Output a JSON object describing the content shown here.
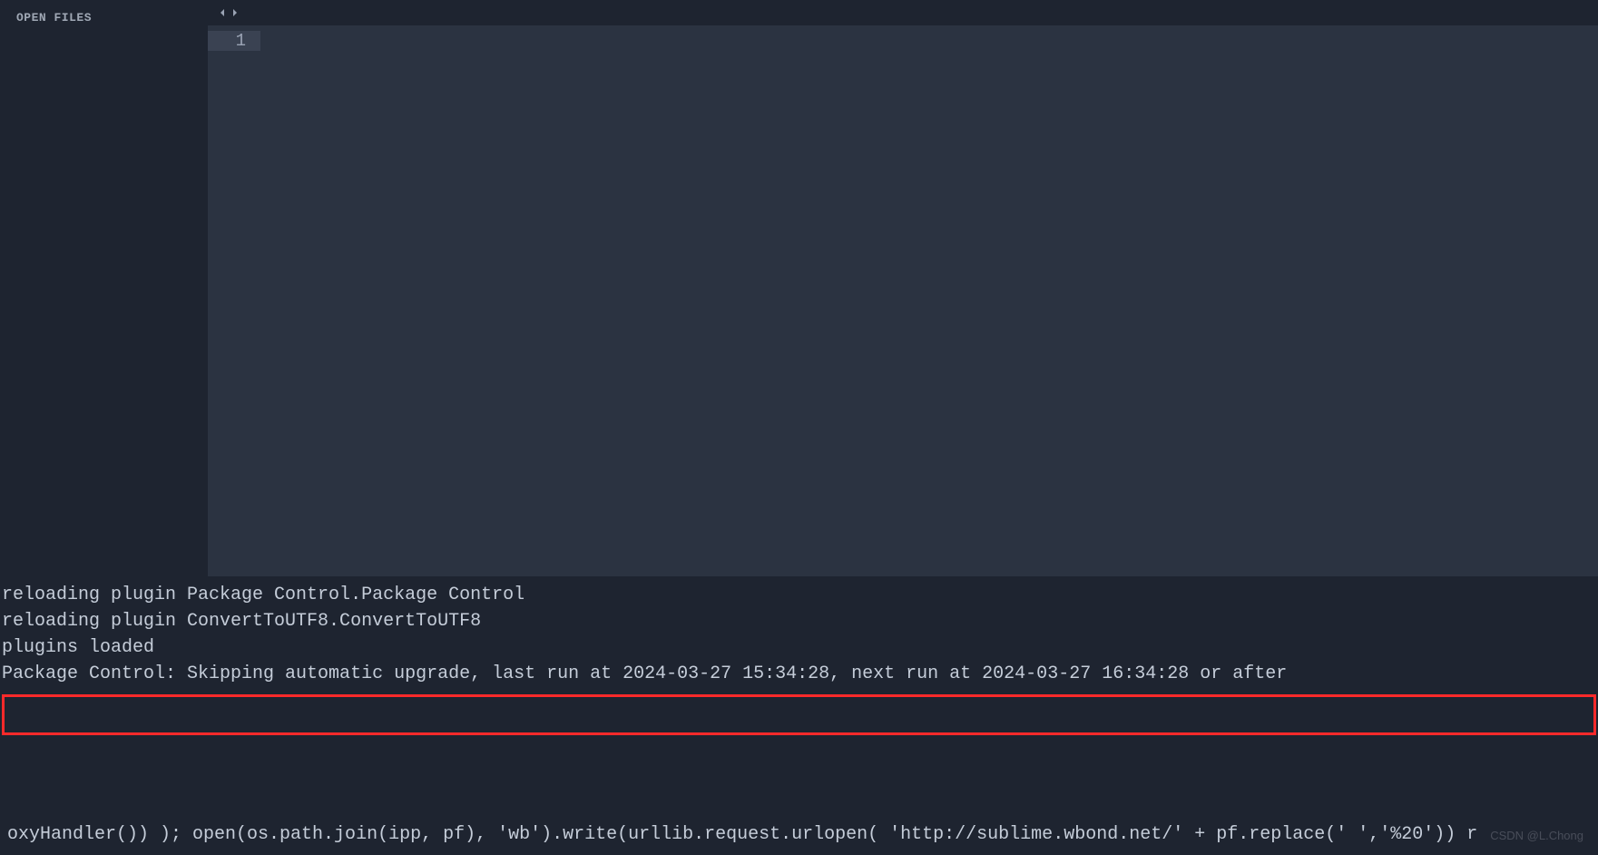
{
  "sidebar": {
    "title": "OPEN FILES"
  },
  "editor": {
    "line_number": "1"
  },
  "console": {
    "lines": [
      "reloading plugin Package Control.Package Control",
      "reloading plugin ConvertToUTF8.ConvertToUTF8",
      "plugins loaded",
      "Package Control: Skipping automatic upgrade, last run at 2024-03-27 15:34:28, next run at 2024-03-27 16:34:28 or after"
    ],
    "input": "oxyHandler()) ); open(os.path.join(ipp, pf), 'wb').write(urllib.request.urlopen( 'http://sublime.wbond.net/' + pf.replace(' ','%20')) r"
  },
  "watermark": "CSDN @L.Chong"
}
